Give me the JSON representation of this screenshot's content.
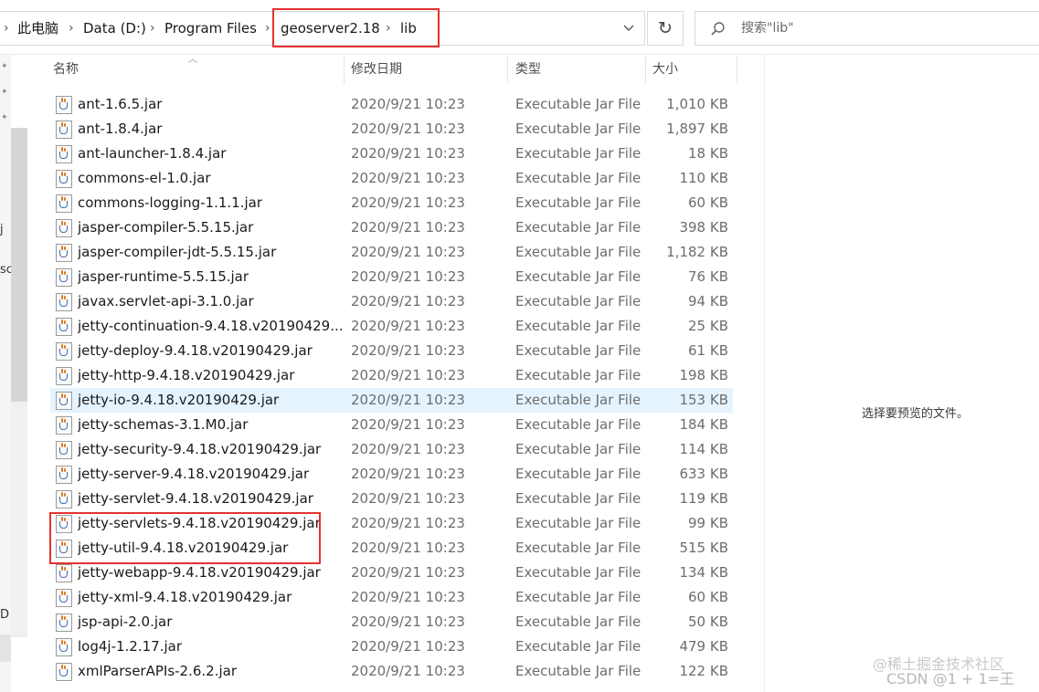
{
  "address_bar": {
    "crumbs": [
      "此电脑",
      "Data (D:)",
      "Program Files",
      "geoserver2.18",
      "lib"
    ],
    "separator": "›",
    "dropdown_glyph": "⌄",
    "refresh_glyph": "↻"
  },
  "search": {
    "placeholder": "搜索\"lib\""
  },
  "left_nav": {
    "fragments": [
      "[",
      "j",
      "sc",
      "D ("
    ]
  },
  "columns": {
    "name": "名称",
    "date": "修改日期",
    "type": "类型",
    "size": "大小"
  },
  "files": [
    {
      "name": "ant-1.6.5.jar",
      "date": "2020/9/21 10:23",
      "type": "Executable Jar File",
      "size": "1,010 KB"
    },
    {
      "name": "ant-1.8.4.jar",
      "date": "2020/9/21 10:23",
      "type": "Executable Jar File",
      "size": "1,897 KB"
    },
    {
      "name": "ant-launcher-1.8.4.jar",
      "date": "2020/9/21 10:23",
      "type": "Executable Jar File",
      "size": "18 KB"
    },
    {
      "name": "commons-el-1.0.jar",
      "date": "2020/9/21 10:23",
      "type": "Executable Jar File",
      "size": "110 KB"
    },
    {
      "name": "commons-logging-1.1.1.jar",
      "date": "2020/9/21 10:23",
      "type": "Executable Jar File",
      "size": "60 KB"
    },
    {
      "name": "jasper-compiler-5.5.15.jar",
      "date": "2020/9/21 10:23",
      "type": "Executable Jar File",
      "size": "398 KB"
    },
    {
      "name": "jasper-compiler-jdt-5.5.15.jar",
      "date": "2020/9/21 10:23",
      "type": "Executable Jar File",
      "size": "1,182 KB"
    },
    {
      "name": "jasper-runtime-5.5.15.jar",
      "date": "2020/9/21 10:23",
      "type": "Executable Jar File",
      "size": "76 KB"
    },
    {
      "name": "javax.servlet-api-3.1.0.jar",
      "date": "2020/9/21 10:23",
      "type": "Executable Jar File",
      "size": "94 KB"
    },
    {
      "name": "jetty-continuation-9.4.18.v20190429....",
      "date": "2020/9/21 10:23",
      "type": "Executable Jar File",
      "size": "25 KB"
    },
    {
      "name": "jetty-deploy-9.4.18.v20190429.jar",
      "date": "2020/9/21 10:23",
      "type": "Executable Jar File",
      "size": "61 KB"
    },
    {
      "name": "jetty-http-9.4.18.v20190429.jar",
      "date": "2020/9/21 10:23",
      "type": "Executable Jar File",
      "size": "198 KB"
    },
    {
      "name": "jetty-io-9.4.18.v20190429.jar",
      "date": "2020/9/21 10:23",
      "type": "Executable Jar File",
      "size": "153 KB"
    },
    {
      "name": "jetty-schemas-3.1.M0.jar",
      "date": "2020/9/21 10:23",
      "type": "Executable Jar File",
      "size": "184 KB"
    },
    {
      "name": "jetty-security-9.4.18.v20190429.jar",
      "date": "2020/9/21 10:23",
      "type": "Executable Jar File",
      "size": "114 KB"
    },
    {
      "name": "jetty-server-9.4.18.v20190429.jar",
      "date": "2020/9/21 10:23",
      "type": "Executable Jar File",
      "size": "633 KB"
    },
    {
      "name": "jetty-servlet-9.4.18.v20190429.jar",
      "date": "2020/9/21 10:23",
      "type": "Executable Jar File",
      "size": "119 KB"
    },
    {
      "name": "jetty-servlets-9.4.18.v20190429.jar",
      "date": "2020/9/21 10:23",
      "type": "Executable Jar File",
      "size": "99 KB"
    },
    {
      "name": "jetty-util-9.4.18.v20190429.jar",
      "date": "2020/9/21 10:23",
      "type": "Executable Jar File",
      "size": "515 KB"
    },
    {
      "name": "jetty-webapp-9.4.18.v20190429.jar",
      "date": "2020/9/21 10:23",
      "type": "Executable Jar File",
      "size": "134 KB"
    },
    {
      "name": "jetty-xml-9.4.18.v20190429.jar",
      "date": "2020/9/21 10:23",
      "type": "Executable Jar File",
      "size": "60 KB"
    },
    {
      "name": "jsp-api-2.0.jar",
      "date": "2020/9/21 10:23",
      "type": "Executable Jar File",
      "size": "50 KB"
    },
    {
      "name": "log4j-1.2.17.jar",
      "date": "2020/9/21 10:23",
      "type": "Executable Jar File",
      "size": "479 KB"
    },
    {
      "name": "xmlParserAPIs-2.6.2.jar",
      "date": "2020/9/21 10:23",
      "type": "Executable Jar File",
      "size": "122 KB"
    }
  ],
  "selected_file": "jetty-io-9.4.18.v20190429.jar",
  "preview": {
    "message": "选择要预览的文件。"
  },
  "watermark": {
    "line1": "@稀土掘金技术社区",
    "line2": "CSDN @1 + 1=王"
  },
  "colors": {
    "highlight_box": "#e5312f",
    "selection": "#e5f3ff",
    "java_icon_blue": "#3d6fb6",
    "java_icon_orange": "#e07a1f"
  },
  "icons": {
    "file": "java-jar-icon",
    "search": "search-icon",
    "refresh": "refresh-icon",
    "dropdown": "chevron-down-icon"
  }
}
